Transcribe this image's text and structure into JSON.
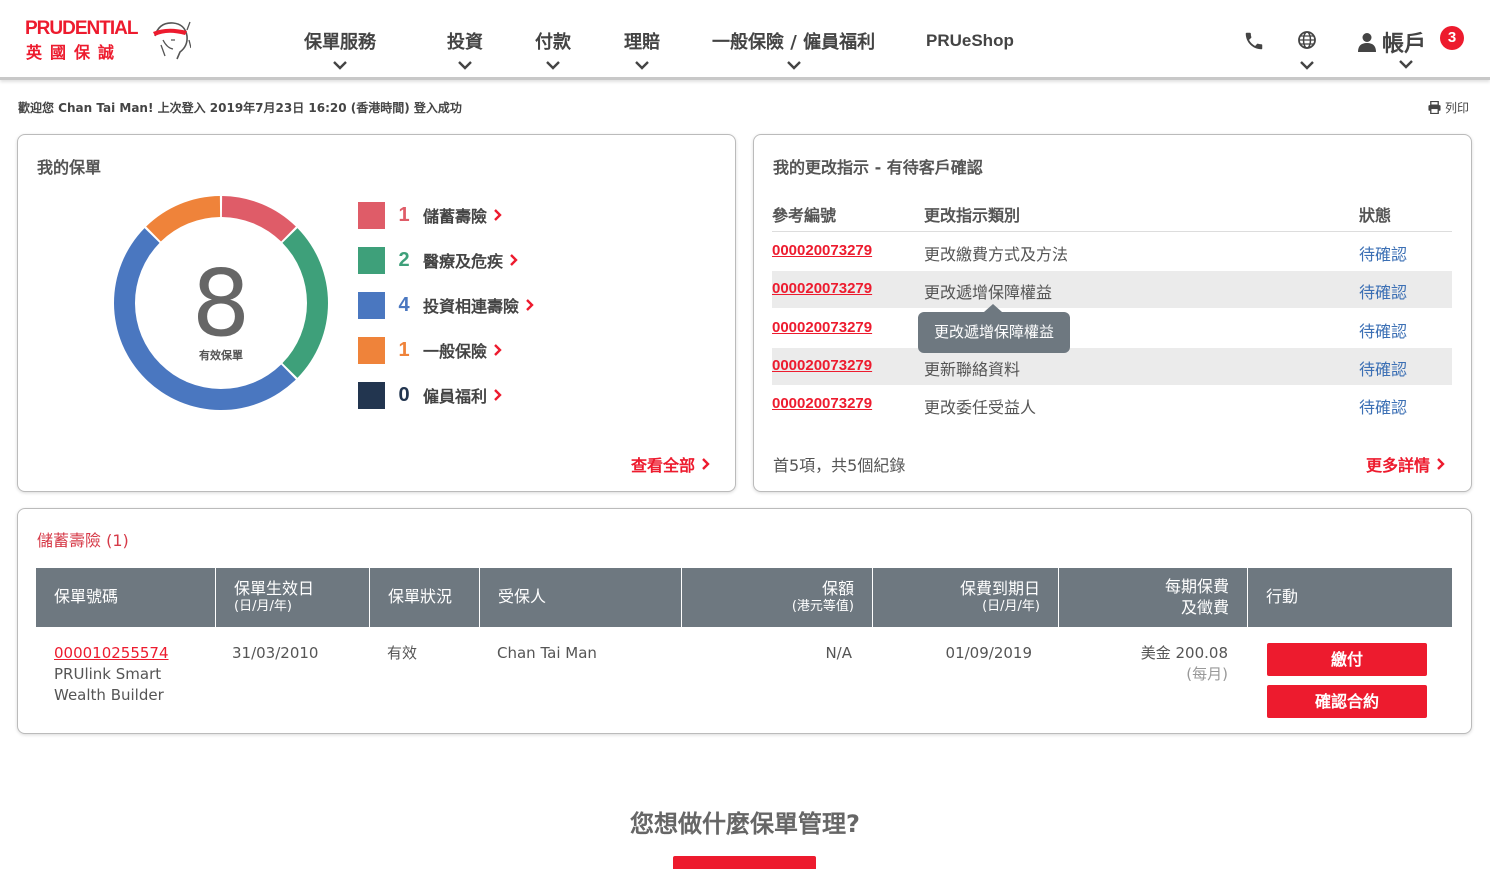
{
  "brand": {
    "name_en": "PRUDENTIAL",
    "name_zh": "英國保誠",
    "primary_color": "#ed1b2e"
  },
  "nav": {
    "items": [
      "保單服務",
      "投資",
      "付款",
      "理賠",
      "一般保險 / 僱員福利"
    ],
    "shop": "PRUeShop",
    "account_label": "帳戶",
    "notification_count": "3"
  },
  "welcome_text": "歡迎您 Chan Tai Man! 上次登入 2019年7月23日 16:20 (香港時間) 登入成功",
  "print_label": "列印",
  "policies": {
    "title": "我的保單",
    "total": "8",
    "total_label": "有效保單",
    "categories": [
      {
        "count": "1",
        "label": "儲蓄壽險",
        "color": "#df5c68"
      },
      {
        "count": "2",
        "label": "醫療及危疾",
        "color": "#3ea07a"
      },
      {
        "count": "4",
        "label": "投資相連壽險",
        "color": "#4a77c0"
      },
      {
        "count": "1",
        "label": "一般保險",
        "color": "#ef833a"
      },
      {
        "count": "0",
        "label": "僱員福利",
        "color": "#22354f"
      }
    ],
    "view_all": "查看全部"
  },
  "instructions": {
    "title": "我的更改指示 - 有待客戶確認",
    "headers": {
      "ref": "參考編號",
      "type": "更改指示類別",
      "status": "狀態"
    },
    "rows": [
      {
        "ref": "000020073279",
        "type": "更改繳費方式及方法",
        "status": "待確認"
      },
      {
        "ref": "000020073279",
        "type": "更改遞增保障權益",
        "status": "待確認"
      },
      {
        "ref": "000020073279",
        "type": "",
        "status": "待確認"
      },
      {
        "ref": "000020073279",
        "type": "更新聯絡資料",
        "status": "待確認"
      },
      {
        "ref": "000020073279",
        "type": "更改委任受益人",
        "status": "待確認"
      }
    ],
    "tooltip": "更改遞增保障權益",
    "footer": "首5項，共5個紀錄",
    "more": "更多詳情"
  },
  "savings": {
    "title": "儲蓄壽險 (1)",
    "headers": {
      "policy_no": "保單號碼",
      "effective": "保單生效日",
      "effective_sub": "(日/月/年)",
      "status": "保單狀況",
      "insured": "受保人",
      "sum": "保額",
      "sum_sub": "(港元等值)",
      "due": "保費到期日",
      "due_sub": "(日/月/年)",
      "premium": "每期保費",
      "premium_sub": "及徵費",
      "action": "行動"
    },
    "row": {
      "policy_no": "000010255574",
      "product_line1": "PRUlink Smart",
      "product_line2": "Wealth Builder",
      "effective": "31/03/2010",
      "status": "有效",
      "insured": "Chan Tai Man",
      "sum": "N/A",
      "due": "01/09/2019",
      "premium": "美金 200.08",
      "premium_freq": "(每月)",
      "btn_pay": "繳付",
      "btn_confirm": "確認合約"
    }
  },
  "bottom_title": "您想做什麼保單管理?"
}
